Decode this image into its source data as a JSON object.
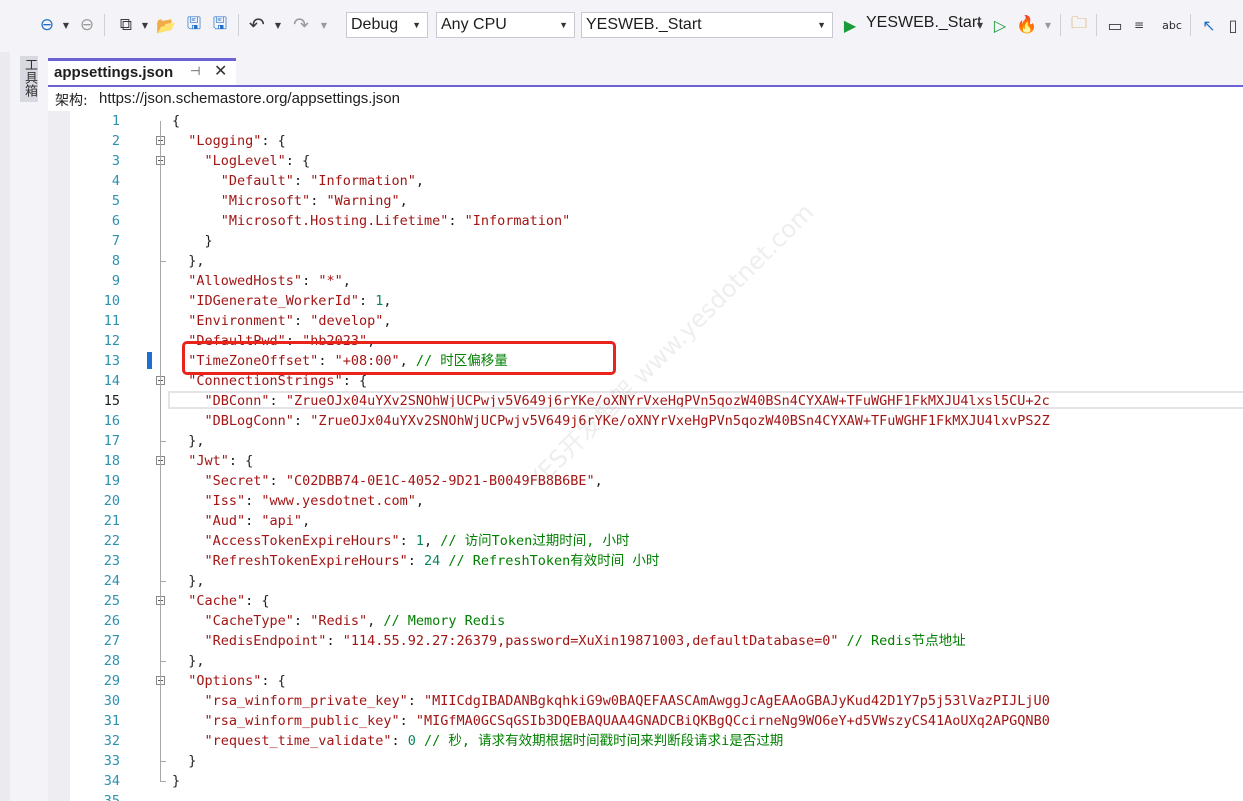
{
  "toolbar": {
    "config": "Debug",
    "platform": "Any CPU",
    "startup_project": "YESWEB._Start",
    "run_label": "YESWEB._Start"
  },
  "toolbox": {
    "label": "工具箱"
  },
  "tab": {
    "title": "appsettings.json",
    "pin": "⊣",
    "close": "✕"
  },
  "schema": {
    "label": "架构:",
    "url": "https://json.schemastore.org/appsettings.json"
  },
  "watermark": {
    "text": "YES开发框架 www.yesdotnet.com"
  },
  "editor": {
    "current_line": 15,
    "lines": [
      {
        "n": "1",
        "t": "{"
      },
      {
        "n": "2",
        "t": "  \"Logging\": {"
      },
      {
        "n": "3",
        "t": "    \"LogLevel\": {"
      },
      {
        "n": "4",
        "t": "      \"Default\": \"Information\","
      },
      {
        "n": "5",
        "t": "      \"Microsoft\": \"Warning\","
      },
      {
        "n": "6",
        "t": "      \"Microsoft.Hosting.Lifetime\": \"Information\""
      },
      {
        "n": "7",
        "t": "    }"
      },
      {
        "n": "8",
        "t": "  },"
      },
      {
        "n": "9",
        "t": "  \"AllowedHosts\": \"*\","
      },
      {
        "n": "10",
        "t": "  \"IDGenerate_WorkerId\": 1,"
      },
      {
        "n": "11",
        "t": "  \"Environment\": \"develop\","
      },
      {
        "n": "12",
        "t": "  \"DefaultPwd\": \"hb2023\","
      },
      {
        "n": "13",
        "t": "  \"TimeZoneOffset\": \"+08:00\", // 时区偏移量"
      },
      {
        "n": "14",
        "t": "  \"ConnectionStrings\": {"
      },
      {
        "n": "15",
        "t": "    \"DBConn\": \"ZrueOJx04uYXv2SNOhWjUCPwjv5V649j6rYKe/oXNYrVxeHgPVn5qozW40BSn4CYXAW+TFuWGHF1FkMXJU4lxsl5CU+2c"
      },
      {
        "n": "16",
        "t": "    \"DBLogConn\": \"ZrueOJx04uYXv2SNOhWjUCPwjv5V649j6rYKe/oXNYrVxeHgPVn5qozW40BSn4CYXAW+TFuWGHF1FkMXJU4lxvPS2Z"
      },
      {
        "n": "17",
        "t": "  },"
      },
      {
        "n": "18",
        "t": "  \"Jwt\": {"
      },
      {
        "n": "19",
        "t": "    \"Secret\": \"C02DBB74-0E1C-4052-9D21-B0049FB8B6BE\","
      },
      {
        "n": "20",
        "t": "    \"Iss\": \"www.yesdotnet.com\","
      },
      {
        "n": "21",
        "t": "    \"Aud\": \"api\","
      },
      {
        "n": "22",
        "t": "    \"AccessTokenExpireHours\": 1, // 访问Token过期时间, 小时"
      },
      {
        "n": "23",
        "t": "    \"RefreshTokenExpireHours\": 24 // RefreshToken有效时间 小时"
      },
      {
        "n": "24",
        "t": "  },"
      },
      {
        "n": "25",
        "t": "  \"Cache\": {"
      },
      {
        "n": "26",
        "t": "    \"CacheType\": \"Redis\", // Memory Redis"
      },
      {
        "n": "27",
        "t": "    \"RedisEndpoint\": \"114.55.92.27:26379,password=XuXin19871003,defaultDatabase=0\" // Redis节点地址"
      },
      {
        "n": "28",
        "t": "  },"
      },
      {
        "n": "29",
        "t": "  \"Options\": {"
      },
      {
        "n": "30",
        "t": "    \"rsa_winform_private_key\": \"MIICdgIBADANBgkqhkiG9w0BAQEFAASCAmAwggJcAgEAAoGBAJyKud42D1Y7p5j53lVazPIJLjU0"
      },
      {
        "n": "31",
        "t": "    \"rsa_winform_public_key\": \"MIGfMA0GCSqGSIb3DQEBAQUAA4GNADCBiQKBgQCcirneNg9WO6eY+d5VWszyCS41AoUXq2APGQNB0"
      },
      {
        "n": "32",
        "t": "    \"request_time_validate\": 0 // 秒, 请求有效期根据时间戳时间来判断段请求i是否过期"
      },
      {
        "n": "33",
        "t": "  }"
      },
      {
        "n": "34",
        "t": "}"
      },
      {
        "n": "35",
        "t": ""
      }
    ]
  }
}
